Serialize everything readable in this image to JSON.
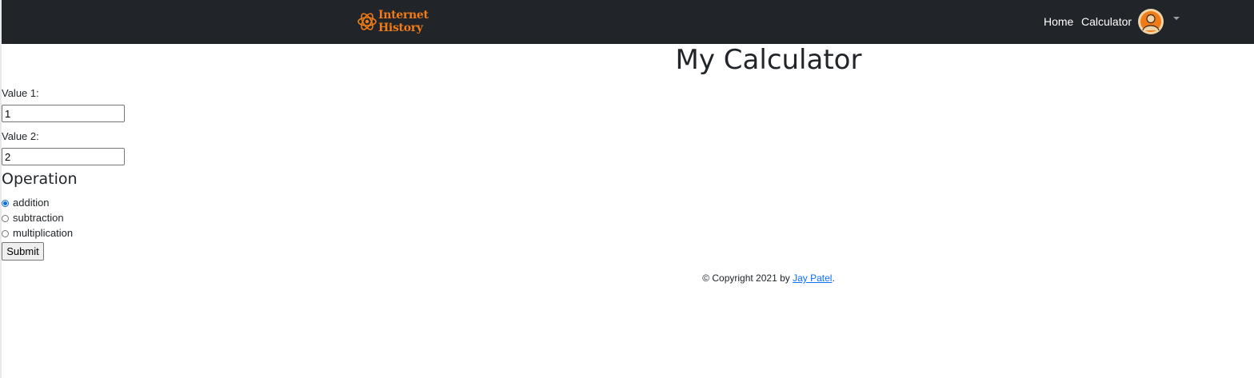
{
  "navbar": {
    "brand": {
      "line1": "Internet",
      "line2": "History"
    },
    "links": [
      {
        "label": "Home"
      },
      {
        "label": "Calculator"
      }
    ],
    "colors": {
      "background": "#212529",
      "brand": "#f07b17"
    }
  },
  "main": {
    "title": "My Calculator",
    "value1": {
      "label": "Value 1:",
      "value": "1"
    },
    "value2": {
      "label": "Value 2:",
      "value": "2"
    },
    "operation": {
      "heading": "Operation",
      "options": [
        {
          "label": "addition",
          "checked": true
        },
        {
          "label": "subtraction",
          "checked": false
        },
        {
          "label": "multiplication",
          "checked": false
        }
      ]
    },
    "submit_label": "Submit"
  },
  "footer": {
    "prefix": "© Copyright 2021 by",
    "author": "Jay Patel",
    "suffix": "."
  }
}
